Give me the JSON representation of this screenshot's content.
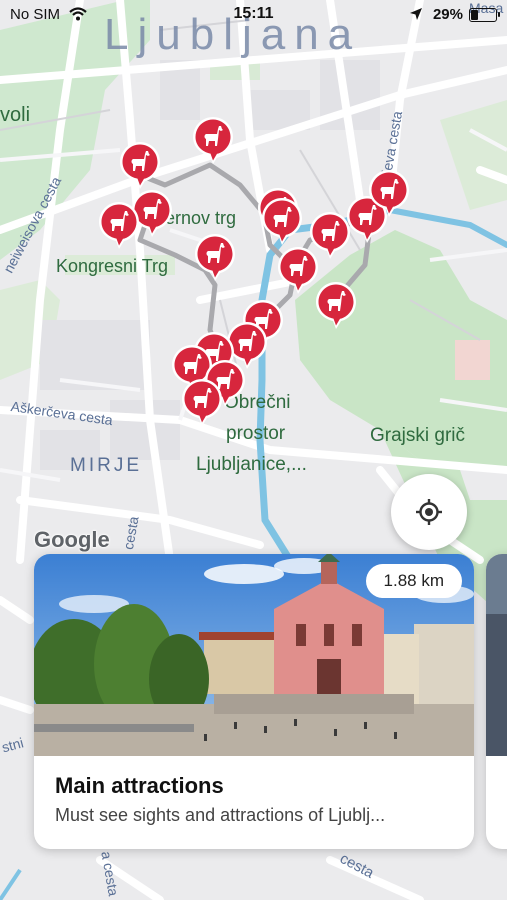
{
  "status_bar": {
    "carrier": "No SIM",
    "time": "15:11",
    "battery": "29%",
    "wifi_icon": "wifi-icon",
    "location_icon": "location-arrow-icon",
    "battery_icon": "battery-icon"
  },
  "map": {
    "city_label": "Ljubljana",
    "district_label": "MIRJE",
    "labels": {
      "tivoli": "voli",
      "kongresni": "Kongresni Trg",
      "presernov": "ernov trg",
      "grajski": "Grajski grič",
      "obrecni_1": "Obrečni",
      "obrecni_2": "prostor",
      "obrecni_3": "Ljubljanice,...",
      "askerceva": "Aškerčeva cesta",
      "kolodvorska": "ljeva cesta",
      "masarykova": "Masa",
      "celovska": "neiweisova cesta",
      "left_street": "cesta",
      "bottom_left": "stni",
      "bottom_center": "a cesta",
      "bottom_right": "cesta"
    },
    "google_logo": "Google",
    "locate_icon": "crosshair-icon",
    "accent_color": "#d7263d"
  },
  "card": {
    "distance": "1.88 km",
    "title": "Main attractions",
    "subtitle": "Must see sights and attractions of Ljublj..."
  }
}
